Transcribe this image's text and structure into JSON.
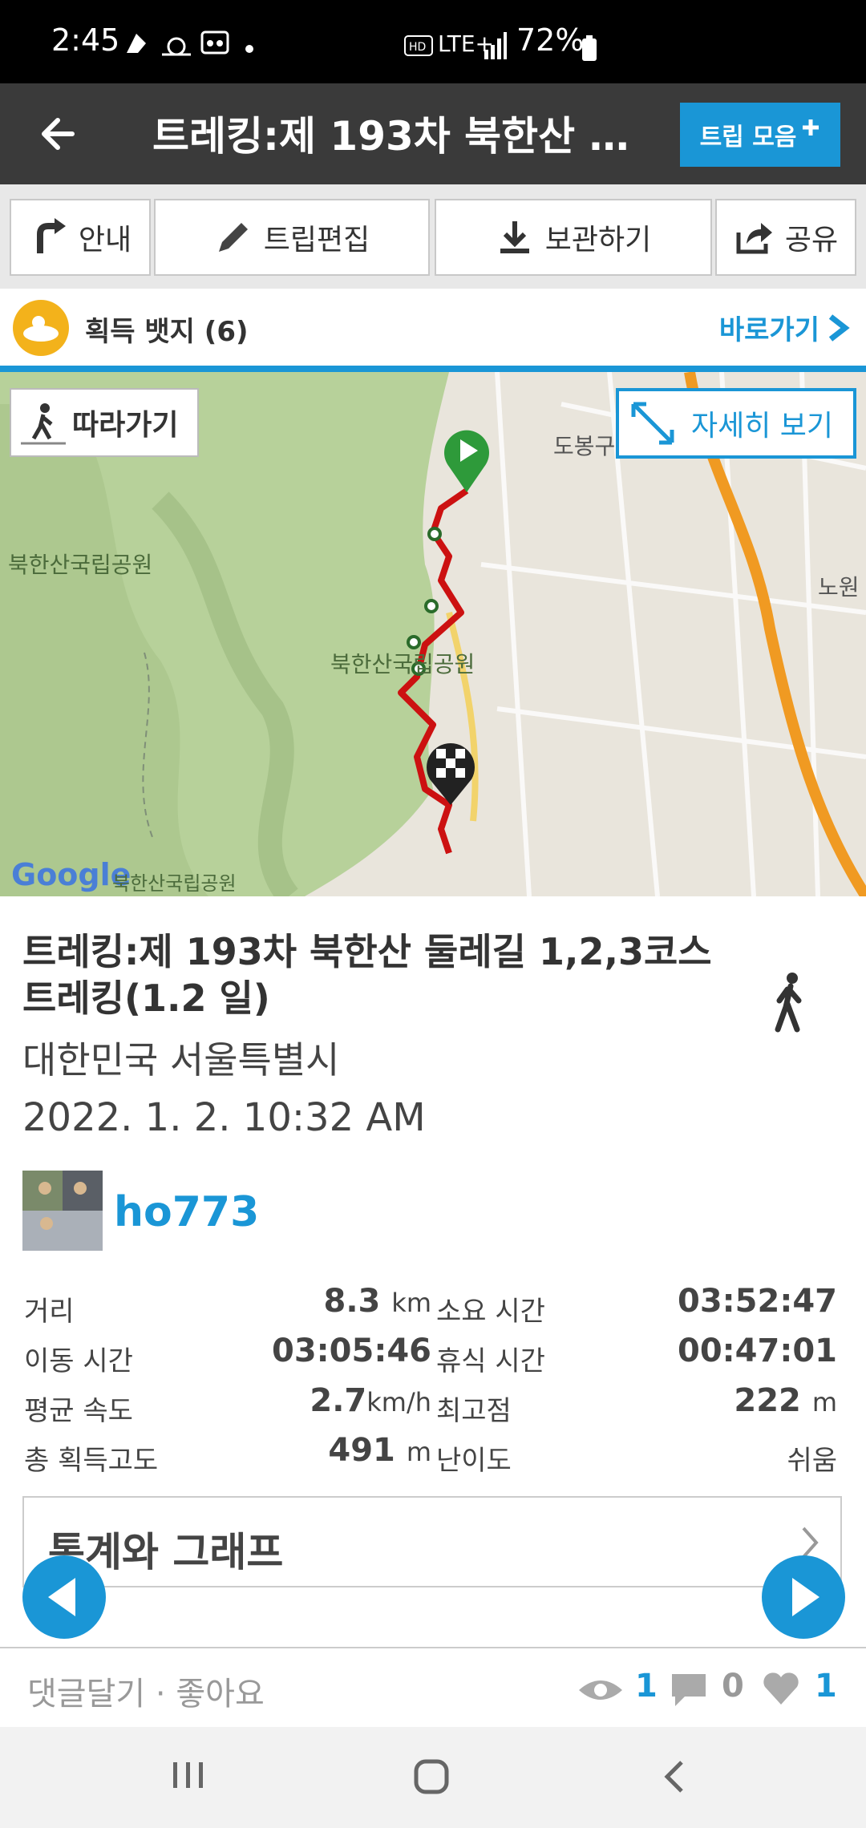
{
  "status_bar": {
    "time": "2:45",
    "network": "LTE+",
    "battery": "72%",
    "icons": [
      "gesture-icon",
      "weather-icon",
      "voicemail-icon",
      "dot-icon",
      "hd-icon",
      "signal-icon",
      "battery-icon"
    ]
  },
  "header": {
    "title": "트레킹:제 193차 북한산 둘…",
    "trip_collection_label": "트립 모음"
  },
  "toolbar": {
    "guide_label": "안내",
    "edit_label": "트립편집",
    "save_label": "보관하기",
    "share_label": "공유"
  },
  "badges": {
    "label": "획득 뱃지 (6)",
    "shortcut_label": "바로가기"
  },
  "map": {
    "follow_label": "따라가기",
    "detail_label": "자세히 보기",
    "place_labels": [
      "북한산국립공원",
      "북한산국립공원",
      "도봉구",
      "노원",
      "Google",
      "북한산국립공원"
    ]
  },
  "trip": {
    "title": "트레킹:제 193차 북한산 둘레길 1,2,3코스 트레킹(1.2 일)",
    "location": "대한민국 서울특별시",
    "date": "2022. 1. 2. 10:32 AM",
    "username": "ho773",
    "activity_icon": "walking-icon"
  },
  "stats": [
    {
      "label": "거리",
      "value": "8.3",
      "unit": "km"
    },
    {
      "label": "소요 시간",
      "value": "03:52:47",
      "unit": ""
    },
    {
      "label": "이동 시간",
      "value": "03:05:46",
      "unit": ""
    },
    {
      "label": "휴식 시간",
      "value": "00:47:01",
      "unit": ""
    },
    {
      "label": "평균 속도",
      "value": "2.7",
      "unit": "km/h"
    },
    {
      "label": "최고점",
      "value": "222",
      "unit": "m"
    },
    {
      "label": "총 획득고도",
      "value": "491",
      "unit": "m"
    },
    {
      "label": "난이도",
      "value": "쉬움",
      "unit": ""
    }
  ],
  "stats_graph_label": "통계와 그래프",
  "footer": {
    "comment_like_label": "댓글달기 · 좋아요",
    "views": "1",
    "comments": "0",
    "likes": "1"
  },
  "colors": {
    "accent": "#1a96d6",
    "header_bg": "#3a3a3a",
    "route": "#cc1111"
  }
}
